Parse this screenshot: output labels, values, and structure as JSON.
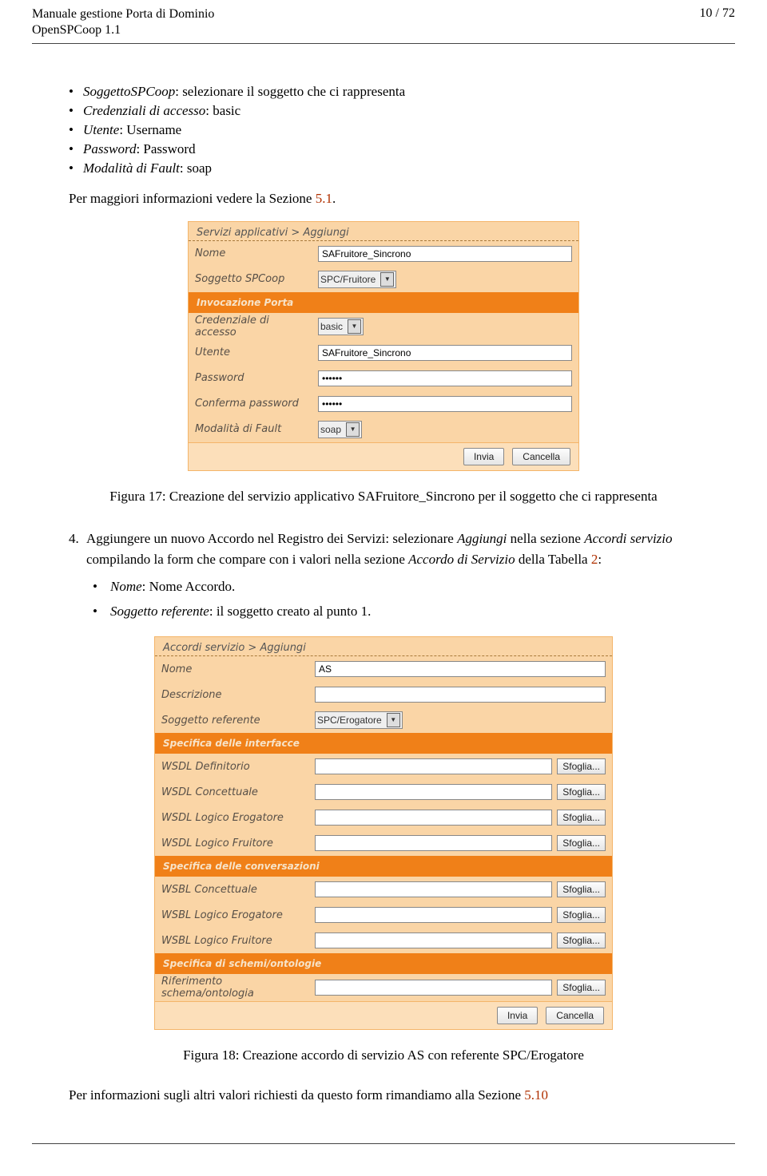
{
  "header": {
    "title_line1": "Manuale gestione Porta di Dominio",
    "title_line2": "OpenSPCoop 1.1",
    "page_num": "10 / 72"
  },
  "bullets_top": {
    "b1_key": "SoggettoSPCoop",
    "b1_rest": ": selezionare il soggetto che ci rappresenta",
    "b2_key": "Credenziali di accesso",
    "b2_rest": ": basic",
    "b3_key": "Utente",
    "b3_rest": ": Username",
    "b4_key": "Password",
    "b4_rest": ": Password",
    "b5_key": "Modalità di Fault",
    "b5_rest": ": soap"
  },
  "para_more_info": {
    "pre": "Per maggiori informazioni vedere la Sezione ",
    "link": "5.1",
    "post": "."
  },
  "figure17": {
    "breadcrumb": "Servizi applicativi > Aggiungi",
    "rows": {
      "nome_label": "Nome",
      "nome_value": "SAFruitore_Sincrono",
      "sogg_label": "Soggetto SPCoop",
      "sogg_value": "SPC/Fruitore",
      "section_inv": "Invocazione Porta",
      "cred_label": "Credenziale di accesso",
      "cred_value": "basic",
      "utente_label": "Utente",
      "utente_value": "SAFruitore_Sincrono",
      "pw_label": "Password",
      "pw_value": "••••••",
      "pw2_label": "Conferma password",
      "pw2_value": "••••••",
      "fault_label": "Modalità di Fault",
      "fault_value": "soap"
    },
    "buttons": {
      "invia": "Invia",
      "cancella": "Cancella"
    },
    "caption": "Figura 17: Creazione del servizio applicativo SAFruitore_Sincrono per il soggetto che ci rappresenta"
  },
  "step4": {
    "num": "4.",
    "pre": "Aggiungere un nuovo Accordo nel Registro dei Servizi: selezionare ",
    "i1": "Aggiungi",
    "mid1": " nella sezione ",
    "i2": "Accordi servizio",
    "mid2": " compilando la form che compare con i valori nella sezione ",
    "i3": "Accordo di Servizio",
    "mid3": " della Tabella ",
    "link": "2",
    "post": ":",
    "sub1_key": "Nome",
    "sub1_rest": ": Nome Accordo.",
    "sub2_key": "Soggetto referente",
    "sub2_rest": ": il soggetto creato al punto 1."
  },
  "figure18": {
    "breadcrumb": "Accordi servizio > Aggiungi",
    "rows": {
      "nome_label": "Nome",
      "nome_value": "AS",
      "descr_label": "Descrizione",
      "descr_value": "",
      "sogg_label": "Soggetto referente",
      "sogg_value": "SPC/Erogatore",
      "sec_iface": "Specifica delle interfacce",
      "wsdl_def_label": "WSDL Definitorio",
      "wsdl_con_label": "WSDL Concettuale",
      "wsdl_le_label": "WSDL Logico Erogatore",
      "wsdl_lf_label": "WSDL Logico Fruitore",
      "sec_conv": "Specifica delle conversazioni",
      "wsbl_con_label": "WSBL Concettuale",
      "wsbl_le_label": "WSBL Logico Erogatore",
      "wsbl_lf_label": "WSBL Logico Fruitore",
      "sec_schemi": "Specifica di schemi/ontologie",
      "rif_label": "Riferimento schema/ontologia"
    },
    "sfoglia": "Sfoglia...",
    "buttons": {
      "invia": "Invia",
      "cancella": "Cancella"
    },
    "caption": "Figura 18: Creazione accordo di servizio AS con referente SPC/Erogatore"
  },
  "para_bottom": {
    "pre": "Per informazioni sugli altri valori richiesti da questo form rimandiamo alla Sezione ",
    "link": "5.10"
  }
}
